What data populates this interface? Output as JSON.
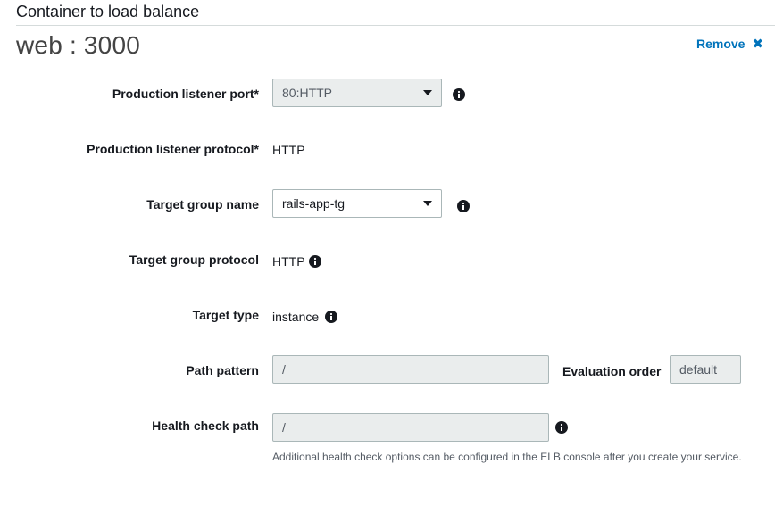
{
  "section": {
    "title": "Container to load balance"
  },
  "container": {
    "title": "web : 3000",
    "remove_label": "Remove"
  },
  "fields": {
    "listener_port": {
      "label": "Production listener port*",
      "value": "80:HTTP"
    },
    "listener_protocol": {
      "label": "Production listener protocol*",
      "value": "HTTP"
    },
    "target_group_name": {
      "label": "Target group name",
      "value": "rails-app-tg"
    },
    "target_group_protocol": {
      "label": "Target group protocol",
      "value": "HTTP"
    },
    "target_type": {
      "label": "Target type",
      "value": "instance"
    },
    "path_pattern": {
      "label": "Path pattern",
      "value": "/"
    },
    "evaluation_order": {
      "label": "Evaluation order",
      "value": "default"
    },
    "health_check_path": {
      "label": "Health check path",
      "value": "/"
    }
  },
  "hint": "Additional health check options can be configured in the ELB console after you create your service.",
  "colors": {
    "link": "#0073bb",
    "border": "#aab7b8",
    "disabled_bg": "#eaeded",
    "divider": "#d5dbdb"
  }
}
